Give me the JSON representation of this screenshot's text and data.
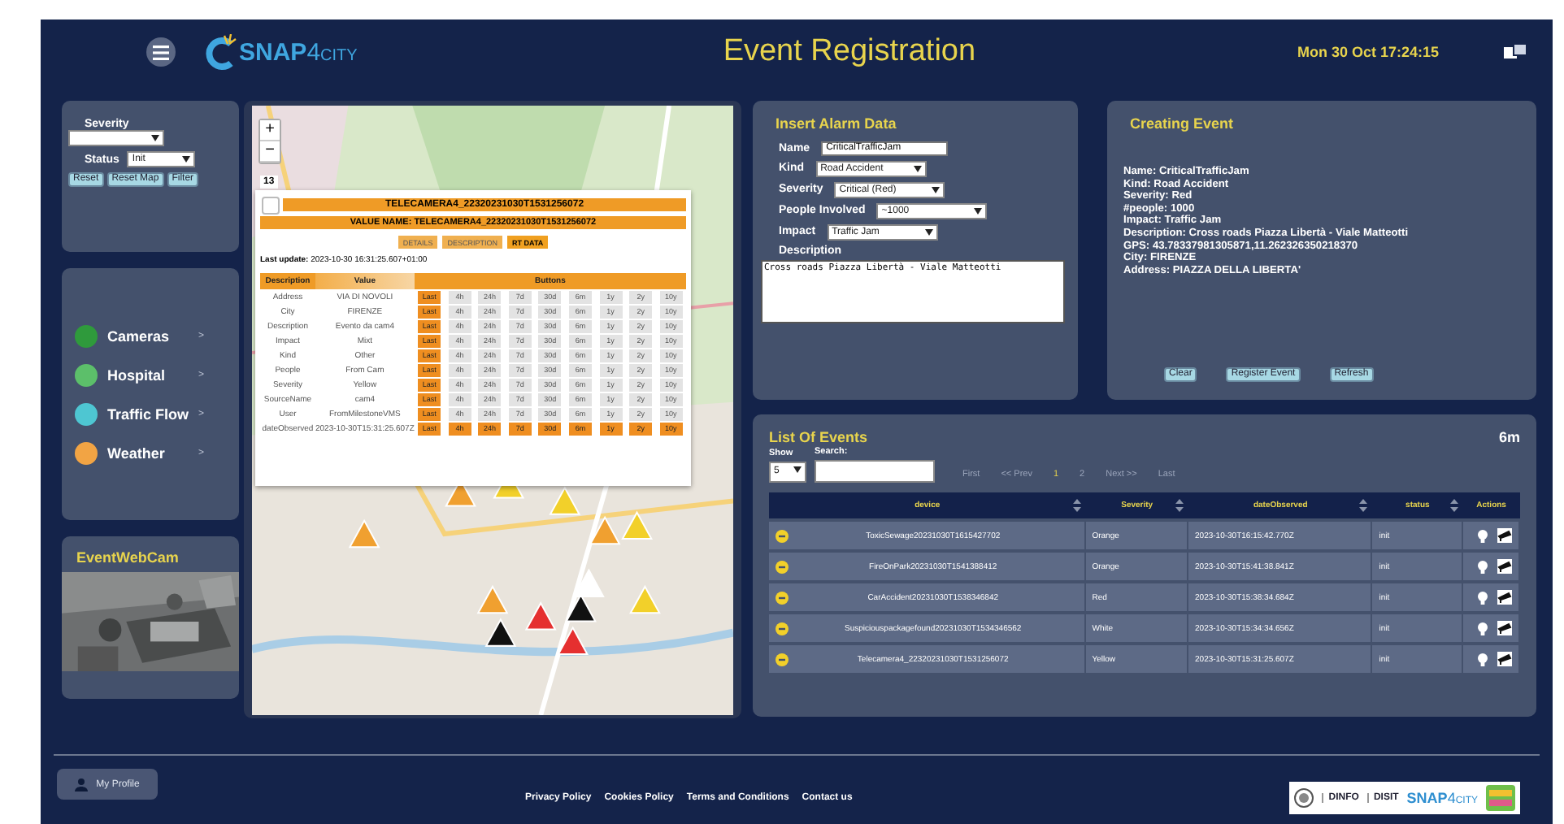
{
  "header": {
    "logo_main": "SNAP",
    "logo_num": "4",
    "logo_sub": "CITY",
    "title": "Event Registration",
    "clock": "Mon 30 Oct 17:24:15"
  },
  "filter": {
    "severity_label": "Severity",
    "status_label": "Status",
    "status_value": "Init",
    "buttons": [
      "Reset",
      "Reset Map",
      "Filter"
    ]
  },
  "categories": [
    {
      "label": "Cameras",
      "color": "#2f9a3c",
      "chevron": ">"
    },
    {
      "label": "Hospital",
      "color": "#5cbf6a",
      "chevron": ">"
    },
    {
      "label": "Traffic Flow",
      "color": "#4ec6d2",
      "chevron": ">"
    },
    {
      "label": "Weather",
      "color": "#f2a444",
      "chevron": ">"
    }
  ],
  "webcam": {
    "title": "EventWebCam",
    "kind": "picture"
  },
  "map": {
    "zoom_in": "+",
    "zoom_out": "−",
    "zoom_level": "13",
    "popup": {
      "checked": false,
      "title": "TELECAMERA4_22320231030T1531256072",
      "value_name": "VALUE NAME: TELECAMERA4_22320231030T1531256072",
      "tabs": [
        {
          "label": "DETAILS",
          "selected": false
        },
        {
          "label": "DESCRIPTION",
          "selected": false
        },
        {
          "label": "RT DATA",
          "selected": true
        }
      ],
      "last_update_label": "Last update:",
      "last_update": "2023-10-30 16:31:25.607+01:00",
      "columns": [
        "Description",
        "Value",
        "Buttons"
      ],
      "rows": [
        {
          "description": "Address",
          "value": "VIA DI NOVOLI",
          "buttons": [
            {
              "label": "Last",
              "on": true
            },
            {
              "label": "4h",
              "on": false
            },
            {
              "label": "24h",
              "on": false
            },
            {
              "label": "7d",
              "on": false
            },
            {
              "label": "30d",
              "on": false
            },
            {
              "label": "6m",
              "on": false
            },
            {
              "label": "1y",
              "on": false
            },
            {
              "label": "2y",
              "on": false
            },
            {
              "label": "10y",
              "on": false
            }
          ]
        },
        {
          "description": "City",
          "value": "FIRENZE",
          "buttons": [
            {
              "label": "Last",
              "on": true
            },
            {
              "label": "4h",
              "on": false
            },
            {
              "label": "24h",
              "on": false
            },
            {
              "label": "7d",
              "on": false
            },
            {
              "label": "30d",
              "on": false
            },
            {
              "label": "6m",
              "on": false
            },
            {
              "label": "1y",
              "on": false
            },
            {
              "label": "2y",
              "on": false
            },
            {
              "label": "10y",
              "on": false
            }
          ]
        },
        {
          "description": "Description",
          "value": "Evento da cam4",
          "buttons": [
            {
              "label": "Last",
              "on": true
            },
            {
              "label": "4h",
              "on": false
            },
            {
              "label": "24h",
              "on": false
            },
            {
              "label": "7d",
              "on": false
            },
            {
              "label": "30d",
              "on": false
            },
            {
              "label": "6m",
              "on": false
            },
            {
              "label": "1y",
              "on": false
            },
            {
              "label": "2y",
              "on": false
            },
            {
              "label": "10y",
              "on": false
            }
          ]
        },
        {
          "description": "Impact",
          "value": "Mixt",
          "buttons": [
            {
              "label": "Last",
              "on": true
            },
            {
              "label": "4h",
              "on": false
            },
            {
              "label": "24h",
              "on": false
            },
            {
              "label": "7d",
              "on": false
            },
            {
              "label": "30d",
              "on": false
            },
            {
              "label": "6m",
              "on": false
            },
            {
              "label": "1y",
              "on": false
            },
            {
              "label": "2y",
              "on": false
            },
            {
              "label": "10y",
              "on": false
            }
          ]
        },
        {
          "description": "Kind",
          "value": "Other",
          "buttons": [
            {
              "label": "Last",
              "on": true
            },
            {
              "label": "4h",
              "on": false
            },
            {
              "label": "24h",
              "on": false
            },
            {
              "label": "7d",
              "on": false
            },
            {
              "label": "30d",
              "on": false
            },
            {
              "label": "6m",
              "on": false
            },
            {
              "label": "1y",
              "on": false
            },
            {
              "label": "2y",
              "on": false
            },
            {
              "label": "10y",
              "on": false
            }
          ]
        },
        {
          "description": "People",
          "value": "From Cam",
          "buttons": [
            {
              "label": "Last",
              "on": true
            },
            {
              "label": "4h",
              "on": false
            },
            {
              "label": "24h",
              "on": false
            },
            {
              "label": "7d",
              "on": false
            },
            {
              "label": "30d",
              "on": false
            },
            {
              "label": "6m",
              "on": false
            },
            {
              "label": "1y",
              "on": false
            },
            {
              "label": "2y",
              "on": false
            },
            {
              "label": "10y",
              "on": false
            }
          ]
        },
        {
          "description": "Severity",
          "value": "Yellow",
          "buttons": [
            {
              "label": "Last",
              "on": true
            },
            {
              "label": "4h",
              "on": false
            },
            {
              "label": "24h",
              "on": false
            },
            {
              "label": "7d",
              "on": false
            },
            {
              "label": "30d",
              "on": false
            },
            {
              "label": "6m",
              "on": false
            },
            {
              "label": "1y",
              "on": false
            },
            {
              "label": "2y",
              "on": false
            },
            {
              "label": "10y",
              "on": false
            }
          ]
        },
        {
          "description": "SourceName",
          "value": "cam4",
          "buttons": [
            {
              "label": "Last",
              "on": true
            },
            {
              "label": "4h",
              "on": false
            },
            {
              "label": "24h",
              "on": false
            },
            {
              "label": "7d",
              "on": false
            },
            {
              "label": "30d",
              "on": false
            },
            {
              "label": "6m",
              "on": false
            },
            {
              "label": "1y",
              "on": false
            },
            {
              "label": "2y",
              "on": false
            },
            {
              "label": "10y",
              "on": false
            }
          ]
        },
        {
          "description": "User",
          "value": "FromMilestoneVMS",
          "buttons": [
            {
              "label": "Last",
              "on": true
            },
            {
              "label": "4h",
              "on": false
            },
            {
              "label": "24h",
              "on": false
            },
            {
              "label": "7d",
              "on": false
            },
            {
              "label": "30d",
              "on": false
            },
            {
              "label": "6m",
              "on": false
            },
            {
              "label": "1y",
              "on": false
            },
            {
              "label": "2y",
              "on": false
            },
            {
              "label": "10y",
              "on": false
            }
          ]
        },
        {
          "description": "dateObserved",
          "value": "2023-10-30T15:31:25.607Z",
          "buttons": [
            {
              "label": "Last",
              "on": true
            },
            {
              "label": "4h",
              "on": true
            },
            {
              "label": "24h",
              "on": true
            },
            {
              "label": "7d",
              "on": true
            },
            {
              "label": "30d",
              "on": true
            },
            {
              "label": "6m",
              "on": true
            },
            {
              "label": "1y",
              "on": true
            },
            {
              "label": "2y",
              "on": true
            },
            {
              "label": "10y",
              "on": true
            }
          ]
        }
      ]
    }
  },
  "insert": {
    "title": "Insert Alarm Data",
    "fields": [
      {
        "label": "Name",
        "kind": "text",
        "value": "CriticalTrafficJam"
      },
      {
        "label": "Kind",
        "kind": "select",
        "value": "Road Accident"
      },
      {
        "label": "Severity",
        "kind": "select",
        "value": "Critical (Red)"
      },
      {
        "label": "People Involved",
        "kind": "select",
        "value": "~1000"
      },
      {
        "label": "Impact",
        "kind": "select",
        "value": "Traffic Jam"
      }
    ],
    "description_label": "Description",
    "description": "Cross roads Piazza Libertà - Viale Matteotti"
  },
  "creating": {
    "title": "Creating Event",
    "lines": [
      "Name: CriticalTrafficJam",
      "Kind: Road Accident",
      "Severity: Red",
      "#people: 1000",
      "Impact: Traffic Jam",
      "Description: Cross roads Piazza Libertà - Viale Matteotti",
      "GPS: 43.78337981305871,11.262326350218370",
      "City: FIRENZE",
      "Address: PIAZZA DELLA LIBERTA'"
    ],
    "buttons": [
      "Clear",
      "Register Event",
      "Refresh"
    ]
  },
  "events": {
    "title": "List Of Events",
    "badge": "6m",
    "show_label": "Show",
    "show_value": "5",
    "search_label": "Search:",
    "pager": [
      {
        "label": "First",
        "selected": false
      },
      {
        "label": "<< Prev",
        "selected": false
      },
      {
        "label": "1",
        "selected": true
      },
      {
        "label": "2",
        "selected": false
      },
      {
        "label": "Next >>",
        "selected": false
      },
      {
        "label": "Last",
        "selected": false
      }
    ],
    "columns": [
      {
        "label": "device",
        "sortable": true
      },
      {
        "label": "Severity",
        "sortable": true
      },
      {
        "label": "dateObserved",
        "sortable": true
      },
      {
        "label": "status",
        "sortable": true
      },
      {
        "label": "Actions",
        "sortable": false
      }
    ],
    "rows": [
      {
        "device": "ToxicSewage20231030T1615427702",
        "severity": "Orange",
        "date": "2023-10-30T16:15:42.770Z",
        "status": "init"
      },
      {
        "device": "FireOnPark20231030T1541388412",
        "severity": "Orange",
        "date": "2023-10-30T15:41:38.841Z",
        "status": "init"
      },
      {
        "device": "CarAccident20231030T1538346842",
        "severity": "Red",
        "date": "2023-10-30T15:38:34.684Z",
        "status": "init"
      },
      {
        "device": "Suspiciouspackagefound20231030T1534346562",
        "severity": "White",
        "date": "2023-10-30T15:34:34.656Z",
        "status": "init"
      },
      {
        "device": "Telecamera4_22320231030T1531256072",
        "severity": "Yellow",
        "date": "2023-10-30T15:31:25.607Z",
        "status": "init"
      }
    ]
  },
  "footer": {
    "profile": "My Profile",
    "links": [
      "Privacy Policy",
      "Cookies Policy",
      "Terms and Conditions",
      "Contact us"
    ],
    "partners": [
      "DINFO",
      "DISIT"
    ],
    "logo_main": "SNAP",
    "logo_num": "4",
    "logo_sub": "CITY"
  }
}
